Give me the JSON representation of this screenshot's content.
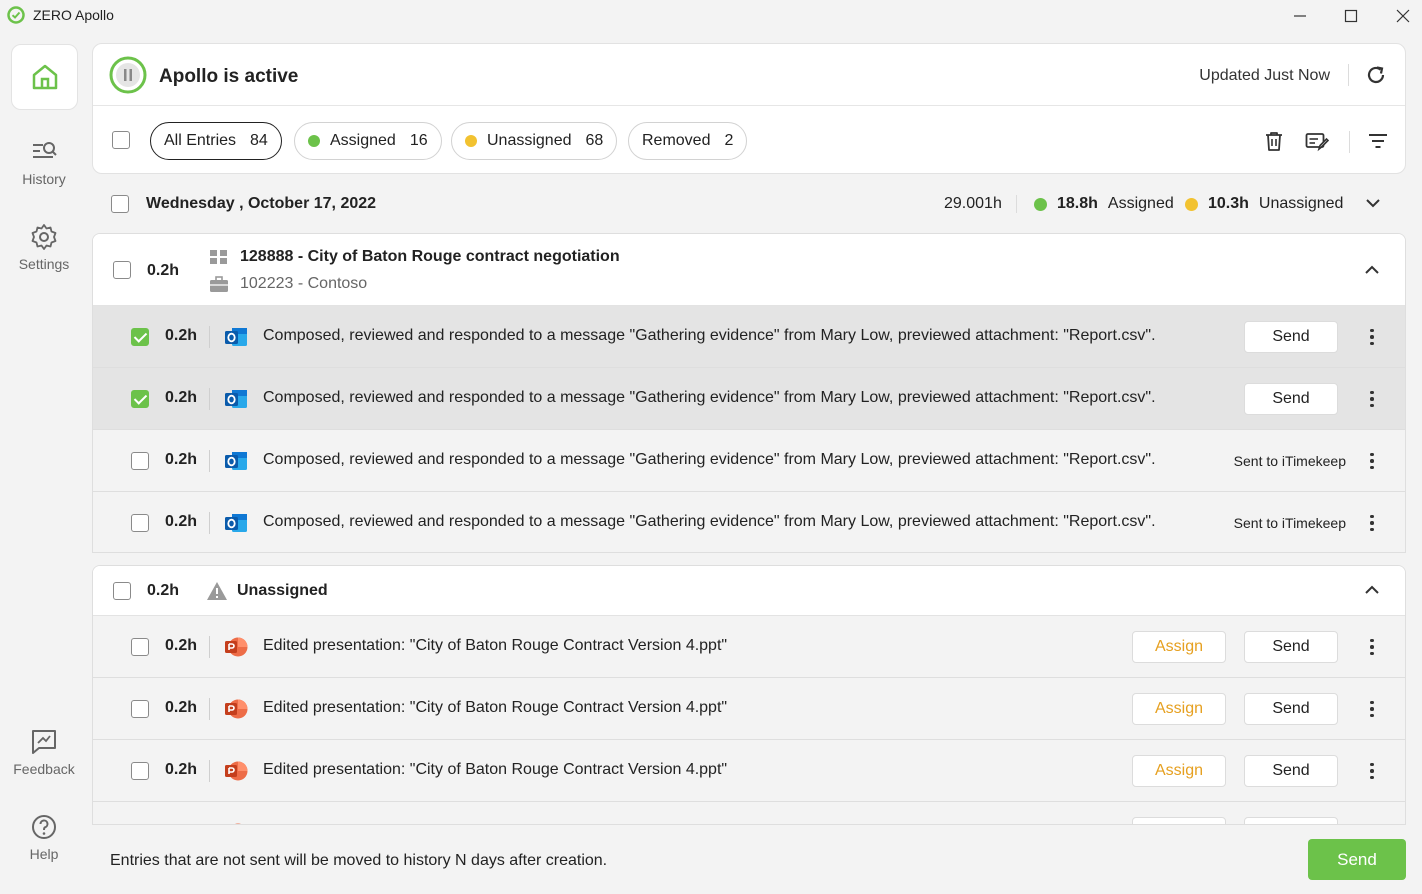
{
  "app": {
    "title": "ZERO Apollo"
  },
  "sidebar": {
    "items": [
      {
        "label": "History"
      },
      {
        "label": "Settings"
      },
      {
        "label": "Feedback"
      },
      {
        "label": "Help"
      }
    ]
  },
  "header": {
    "status_title": "Apollo is active",
    "updated": "Updated Just Now"
  },
  "filters": [
    {
      "label": "All Entries",
      "count": "84"
    },
    {
      "label": "Assigned",
      "count": "16"
    },
    {
      "label": "Unassigned",
      "count": "68"
    },
    {
      "label": "Removed",
      "count": "2"
    }
  ],
  "date_row": {
    "date": "Wednesday , October 17, 2022",
    "total": "29.001h",
    "assigned_hours": "18.8h",
    "assigned_label": "Assigned",
    "unassigned_hours": "10.3h",
    "unassigned_label": "Unassigned"
  },
  "groups": [
    {
      "hours": "0.2h",
      "matter": "128888 - City of Baton Rouge contract negotiation",
      "client": "102223 - Contoso",
      "entries": [
        {
          "hours": "0.2h",
          "desc": "Composed, reviewed and responded to a message \"Gathering evidence\" from Mary Low, previewed attachment: \"Report.csv\".",
          "action": "Send"
        },
        {
          "hours": "0.2h",
          "desc": "Composed, reviewed and responded to a message \"Gathering evidence\" from Mary Low, previewed attachment: \"Report.csv\".",
          "action": "Send"
        },
        {
          "hours": "0.2h",
          "desc": "Composed, reviewed and responded to a message \"Gathering evidence\" from Mary Low, previewed attachment: \"Report.csv\".",
          "status": "Sent to iTimekeep"
        },
        {
          "hours": "0.2h",
          "desc": "Composed, reviewed and responded to a message \"Gathering evidence\" from Mary Low, previewed attachment: \"Report.csv\".",
          "status": "Sent to iTimekeep"
        }
      ]
    },
    {
      "hours": "0.2h",
      "title": "Unassigned",
      "entries": [
        {
          "hours": "0.2h",
          "desc": "Edited presentation: \"City of Baton Rouge Contract Version 4.ppt\"",
          "assign": "Assign",
          "action": "Send"
        },
        {
          "hours": "0.2h",
          "desc": "Edited presentation: \"City of Baton Rouge Contract Version 4.ppt\"",
          "assign": "Assign",
          "action": "Send"
        },
        {
          "hours": "0.2h",
          "desc": "Edited presentation: \"City of Baton Rouge Contract Version 4.ppt\"",
          "assign": "Assign",
          "action": "Send"
        }
      ]
    }
  ],
  "footer": {
    "note": "Entries that are not sent will be moved to history N days after creation.",
    "send": "Send"
  },
  "colors": {
    "accent": "#6cc24a",
    "assigned": "#6cc24a",
    "unassigned": "#f2c230",
    "assign_text": "#e6a020"
  }
}
